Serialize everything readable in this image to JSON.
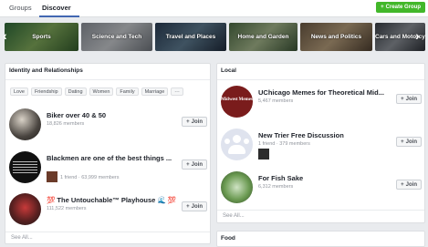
{
  "tabs": [
    {
      "label": "Groups"
    },
    {
      "label": "Discover"
    }
  ],
  "create_button": {
    "icon": "plus-icon",
    "label": "Create Group"
  },
  "categories": [
    {
      "label": "Sports"
    },
    {
      "label": "Science and Tech"
    },
    {
      "label": "Travel and Places"
    },
    {
      "label": "Home and Garden"
    },
    {
      "label": "News and Politics"
    },
    {
      "label": "Cars and Motorcycles"
    }
  ],
  "identity": {
    "title": "Identity and Relationships",
    "chips": [
      "Love",
      "Friendship",
      "Dating",
      "Women",
      "Family",
      "Marriage",
      "···"
    ],
    "groups": [
      {
        "name": "Biker over 40 & 50",
        "meta": "18,826 members",
        "join": "Join"
      },
      {
        "name": "Blackmen are one of the best things ...",
        "meta": "1 friend · 63,999 members",
        "join": "Join"
      },
      {
        "name": "💯 The Untouchable™ Playhouse 🌊 💯",
        "meta": "111,522 members",
        "join": "Join"
      }
    ],
    "see_all": "See All..."
  },
  "local": {
    "title": "Local",
    "groups": [
      {
        "name": "UChicago Memes for Theoretical Mid...",
        "meta": "5,467 members",
        "join": "Join",
        "avatar_text": "Midwest Memes"
      },
      {
        "name": "New Trier Free Discussion",
        "meta": "1 friend · 379 members",
        "join": "Join"
      },
      {
        "name": "For Fish Sake",
        "meta": "6,312 members",
        "join": "Join"
      }
    ],
    "see_all": "See All..."
  },
  "food": {
    "title": "Food"
  },
  "colors": {
    "accent": "#4267b2",
    "create": "#42b72a"
  }
}
